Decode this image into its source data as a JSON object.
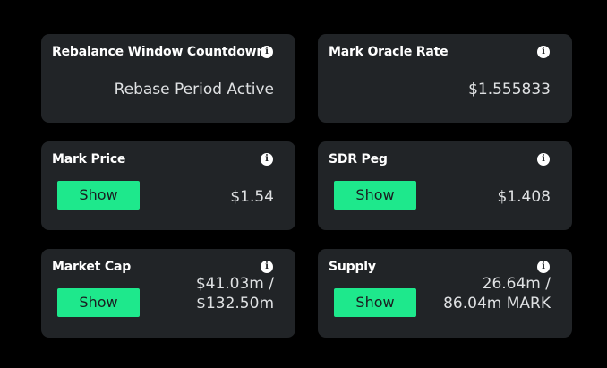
{
  "cards": [
    {
      "title": "Rebalance Window Countdown",
      "value_line1": "Rebase Period Active",
      "has_show": false,
      "icon": "info-icon"
    },
    {
      "title": "Mark Oracle Rate",
      "value_line1": "$1.555833",
      "has_show": false,
      "icon": "info-icon"
    },
    {
      "title": "Mark Price",
      "value_line1": "$1.54",
      "has_show": true,
      "show_label": "Show",
      "icon": "info-icon"
    },
    {
      "title": "SDR Peg",
      "value_line1": "$1.408",
      "has_show": true,
      "show_label": "Show",
      "icon": "info-icon"
    },
    {
      "title": "Market Cap",
      "value_line1": "$41.03m /",
      "value_line2": "$132.50m",
      "has_show": true,
      "show_label": "Show",
      "icon": "info-icon"
    },
    {
      "title": "Supply",
      "value_line1": "26.64m /",
      "value_line2": "86.04m MARK",
      "has_show": true,
      "show_label": "Show",
      "icon": "info-icon"
    }
  ],
  "info_glyph": "i",
  "colors": {
    "background": "#000000",
    "card": "#212427",
    "accent": "#1ee88c",
    "text": "#ffffff",
    "value_text": "#dfe1e3"
  }
}
